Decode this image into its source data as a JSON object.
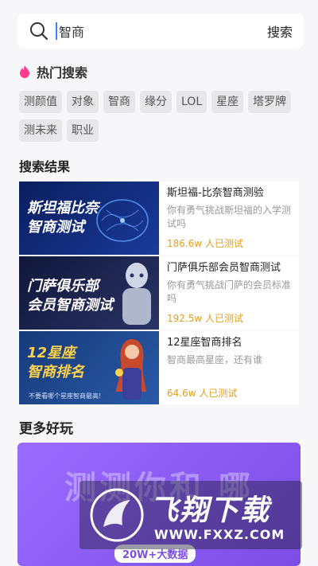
{
  "search": {
    "value": "智商",
    "button_label": "搜索"
  },
  "hot": {
    "title": "热门搜索",
    "tags": [
      "测颜值",
      "对象",
      "智商",
      "缘分",
      "LOL",
      "星座",
      "塔罗牌",
      "测未来",
      "职业"
    ]
  },
  "results": {
    "title": "搜索结果",
    "items": [
      {
        "thumb_text": "斯坦福比奈 智商测试",
        "title": "斯坦福-比奈智商测验",
        "desc": "你有勇气挑战斯坦福的入学测试吗",
        "count": "186.6w 人已测试"
      },
      {
        "thumb_text": "门萨俱乐部 会员智商测试",
        "title": "门萨俱乐部会员智商测试",
        "desc": "你有勇气挑战门萨的会员标准吗",
        "count": "192.5w 人已测试"
      },
      {
        "thumb_text": "12星座 智商排名",
        "thumb_sub": "不要看哪个星座智商最高!",
        "title": "12星座智商排名",
        "desc": "智商最高星座，还有谁",
        "count": "64.6w 人已测试"
      }
    ]
  },
  "more": {
    "title": "更多好玩",
    "banner_text": "测测你和 哪",
    "banner_badge": "20W+大数据"
  },
  "watermark": {
    "text": "飞翔下载",
    "url": "WWW.FXXZ.COM"
  },
  "colors": {
    "accent": "#e0a020",
    "banner": "#8a5cf0",
    "flame": "#ff3b8d"
  }
}
